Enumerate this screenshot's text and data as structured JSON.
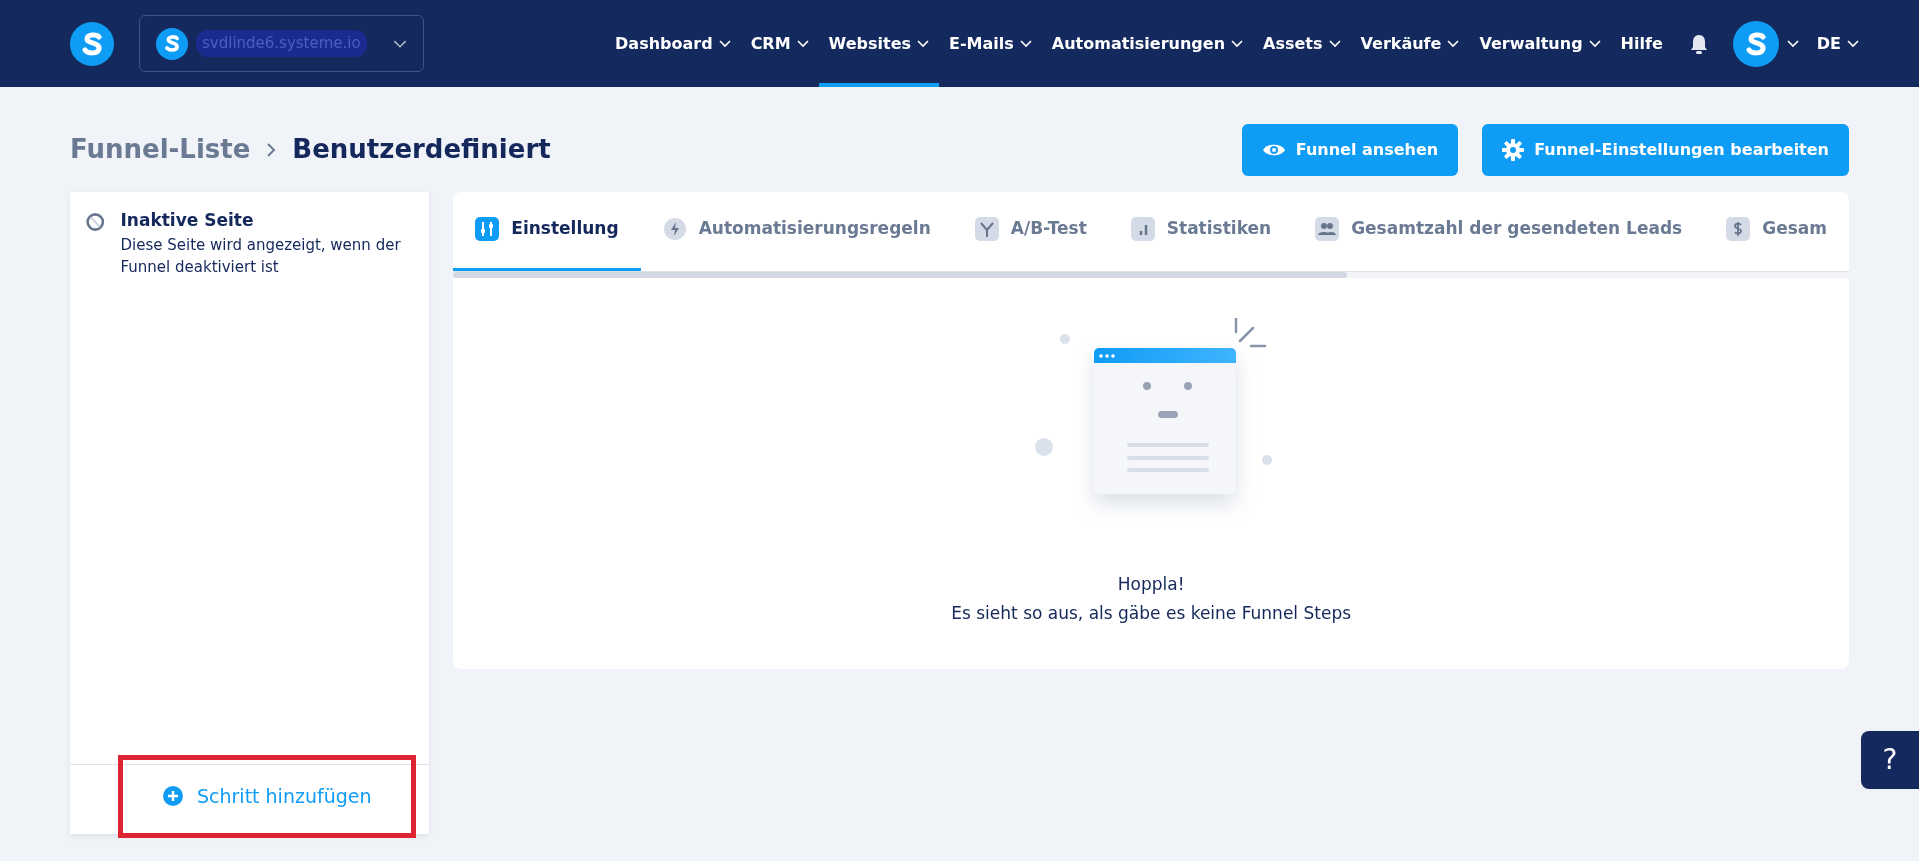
{
  "navbar": {
    "workspace": "svdlinde6.systeme.io",
    "menu": [
      {
        "label": "Dashboard",
        "dropdown": true,
        "selected": false
      },
      {
        "label": "CRM",
        "dropdown": true,
        "selected": false
      },
      {
        "label": "Websites",
        "dropdown": true,
        "selected": true
      },
      {
        "label": "E-Mails",
        "dropdown": true,
        "selected": false
      },
      {
        "label": "Automatisierungen",
        "dropdown": true,
        "selected": false
      },
      {
        "label": "Assets",
        "dropdown": true,
        "selected": false
      },
      {
        "label": "Verkäufe",
        "dropdown": true,
        "selected": false
      },
      {
        "label": "Verwaltung",
        "dropdown": true,
        "selected": false
      },
      {
        "label": "Hilfe",
        "dropdown": false,
        "selected": false
      }
    ],
    "language": "DE"
  },
  "breadcrumb": [
    {
      "label": "Funnel-Liste",
      "current": false
    },
    {
      "label": "Benutzerdefiniert",
      "current": true
    }
  ],
  "actions": [
    {
      "label": "Funnel ansehen",
      "kind": "view"
    },
    {
      "label": "Funnel-Einstellungen bearbeiten",
      "kind": "settings"
    }
  ],
  "sidebar": {
    "steps": [
      {
        "title": "Inaktive Seite",
        "description": "Diese Seite wird angezeigt, wenn der Funnel deaktiviert ist"
      }
    ],
    "add_button": {
      "label": "Schritt hinzufügen",
      "highlighted": true
    }
  },
  "tabs": [
    {
      "label": "Einstellung",
      "selected": true
    },
    {
      "label": "Automatisierungsregeln",
      "selected": false
    },
    {
      "label": "A/B-Test",
      "selected": false
    },
    {
      "label": "Statistiken",
      "selected": false
    },
    {
      "label": "Gesamtzahl der gesendeten Leads",
      "selected": false
    },
    {
      "label": "Gesam",
      "selected": false
    }
  ],
  "empty_state": {
    "title": "Hoppla!",
    "message": "Es sieht so aus, als gäbe es keine Funnel Steps"
  },
  "help_button": "?"
}
